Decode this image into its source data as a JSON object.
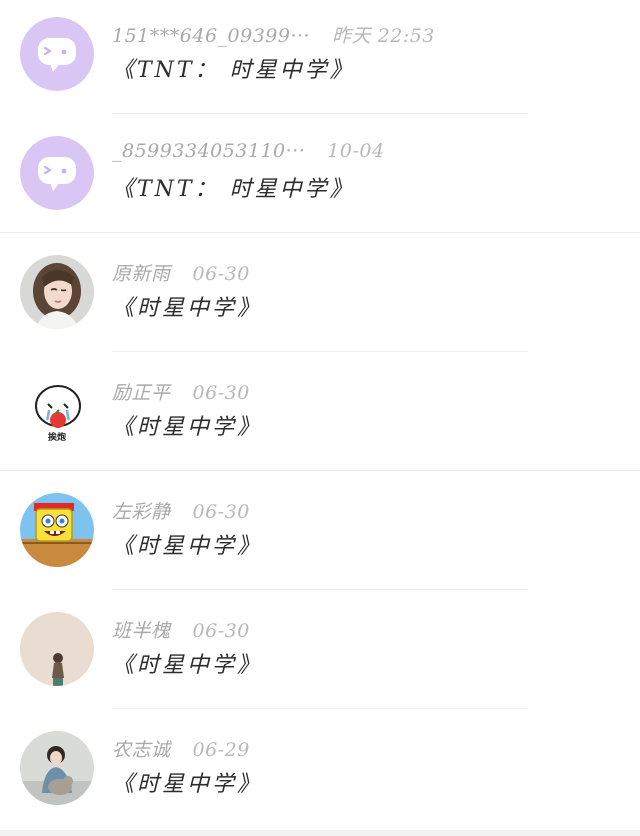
{
  "comments": [
    {
      "user": "151***646_09399···",
      "time": "昨天 22:53",
      "text": "《TNT： 时星中学》",
      "avatar": "anonymous-chat-icon"
    },
    {
      "user": "_8599334053110···",
      "time": "10-04",
      "text": "《TNT： 时星中学》",
      "avatar": "anonymous-chat-icon"
    },
    {
      "user": "原新雨",
      "time": "06-30",
      "text": "《时星中学》",
      "avatar": "girl-winking-photo"
    },
    {
      "user": "励正平",
      "time": "06-30",
      "text": "《时星中学》",
      "avatar": "crying-cartoon-sticker",
      "avatar_caption": "挨炮"
    },
    {
      "user": "左彩静",
      "time": "06-30",
      "text": "《时星中学》",
      "avatar": "spongebob-cartoon"
    },
    {
      "user": "班半槐",
      "time": "06-30",
      "text": "《时星中学》",
      "avatar": "girl-back-photo"
    },
    {
      "user": "农志诚",
      "time": "06-29",
      "text": "《时星中学》",
      "avatar": "girl-with-cat-photo"
    }
  ],
  "colors": {
    "username": "#a9a9a9",
    "comment_text": "#2d2d2d",
    "anonymous_avatar_bg": "#d9c6f5"
  }
}
